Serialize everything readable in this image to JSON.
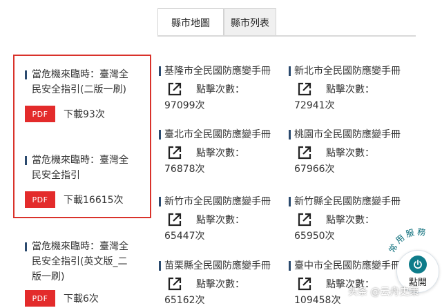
{
  "tabs": [
    {
      "label": "縣市地圖",
      "active": true
    },
    {
      "label": "縣市列表",
      "active": false
    }
  ],
  "documents": [
    {
      "title_line1": "當危機來臨時：臺灣全",
      "title_line2": "民安全指引(二版一刷)",
      "title_line3": "",
      "badge": "PDF",
      "download": "下載93次"
    },
    {
      "title_line1": "當危機來臨時：臺灣全",
      "title_line2": "民安全指引",
      "title_line3": "",
      "badge": "PDF",
      "download": "下載16615次"
    },
    {
      "title_line1": "當危機來臨時：臺灣全",
      "title_line2": "民安全指引(英文版_二",
      "title_line3": "版一刷)",
      "badge": "PDF",
      "download": "下載6次"
    }
  ],
  "manuals": [
    {
      "title": "基隆市全民國防應變手冊",
      "clicks_label": "點擊次數：",
      "count": "97099次"
    },
    {
      "title": "新北市全民國防應變手冊",
      "clicks_label": "點擊次數：",
      "count": "72941次"
    },
    {
      "title": "臺北市全民國防應變手冊",
      "clicks_label": "點擊次數：",
      "count": "76878次"
    },
    {
      "title": "桃園市全民國防應變手冊",
      "clicks_label": "點擊次數：",
      "count": "67966次"
    },
    {
      "title": "新竹市全民國防應變手冊",
      "clicks_label": "點擊次數：",
      "count": "65447次"
    },
    {
      "title": "新竹縣全民國防應變手冊",
      "clicks_label": "點擊次數：",
      "count": "65950次"
    },
    {
      "title": "苗栗縣全民國防應變手冊",
      "clicks_label": "點擊次數：",
      "count": "65162次"
    },
    {
      "title": "臺中市全民國防應變手冊",
      "clicks_label": "點擊次數：",
      "count": "109458次"
    }
  ],
  "service": {
    "arc_label": "常用服務",
    "open_label": "點開"
  },
  "watermark": {
    "text": "头条 @云舟史策"
  },
  "colors": {
    "accent_red": "#e32b2b",
    "highlight_border": "#d9322b",
    "bullet_navy": "#2b4a6e",
    "power_teal": "#0e7c8a"
  }
}
